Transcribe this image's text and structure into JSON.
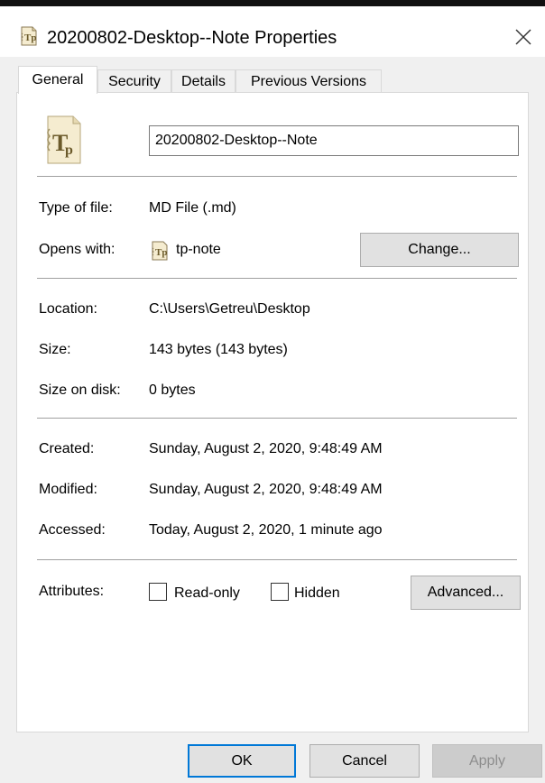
{
  "window": {
    "title": "20200802-Desktop--Note Properties",
    "icon": "tp-note-file-icon",
    "close_icon": "close-icon"
  },
  "tabs": [
    {
      "label": "General",
      "active": true
    },
    {
      "label": "Security",
      "active": false
    },
    {
      "label": "Details",
      "active": false
    },
    {
      "label": "Previous Versions",
      "active": false
    }
  ],
  "general": {
    "file_name": "20200802-Desktop--Note",
    "type_label": "Type of file:",
    "type_value": "MD File (.md)",
    "opens_label": "Opens with:",
    "opens_value": "tp-note",
    "change_button": "Change...",
    "location_label": "Location:",
    "location_value": "C:\\Users\\Getreu\\Desktop",
    "size_label": "Size:",
    "size_value": "143 bytes (143 bytes)",
    "size_on_disk_label": "Size on disk:",
    "size_on_disk_value": "0 bytes",
    "created_label": "Created:",
    "created_value": "Sunday, August 2, 2020, 9:48:49 AM",
    "modified_label": "Modified:",
    "modified_value": "Sunday, August 2, 2020, 9:48:49 AM",
    "accessed_label": "Accessed:",
    "accessed_value": "Today, August 2, 2020, 1 minute ago",
    "attributes_label": "Attributes:",
    "readonly_label": "Read-only",
    "readonly_checked": false,
    "hidden_label": "Hidden",
    "hidden_checked": false,
    "advanced_button": "Advanced..."
  },
  "footer": {
    "ok": "OK",
    "cancel": "Cancel",
    "apply": "Apply"
  },
  "colors": {
    "dialog_background": "#f0f0f0",
    "focus_border": "#0078d7",
    "disabled_text": "#8d8d8d"
  }
}
